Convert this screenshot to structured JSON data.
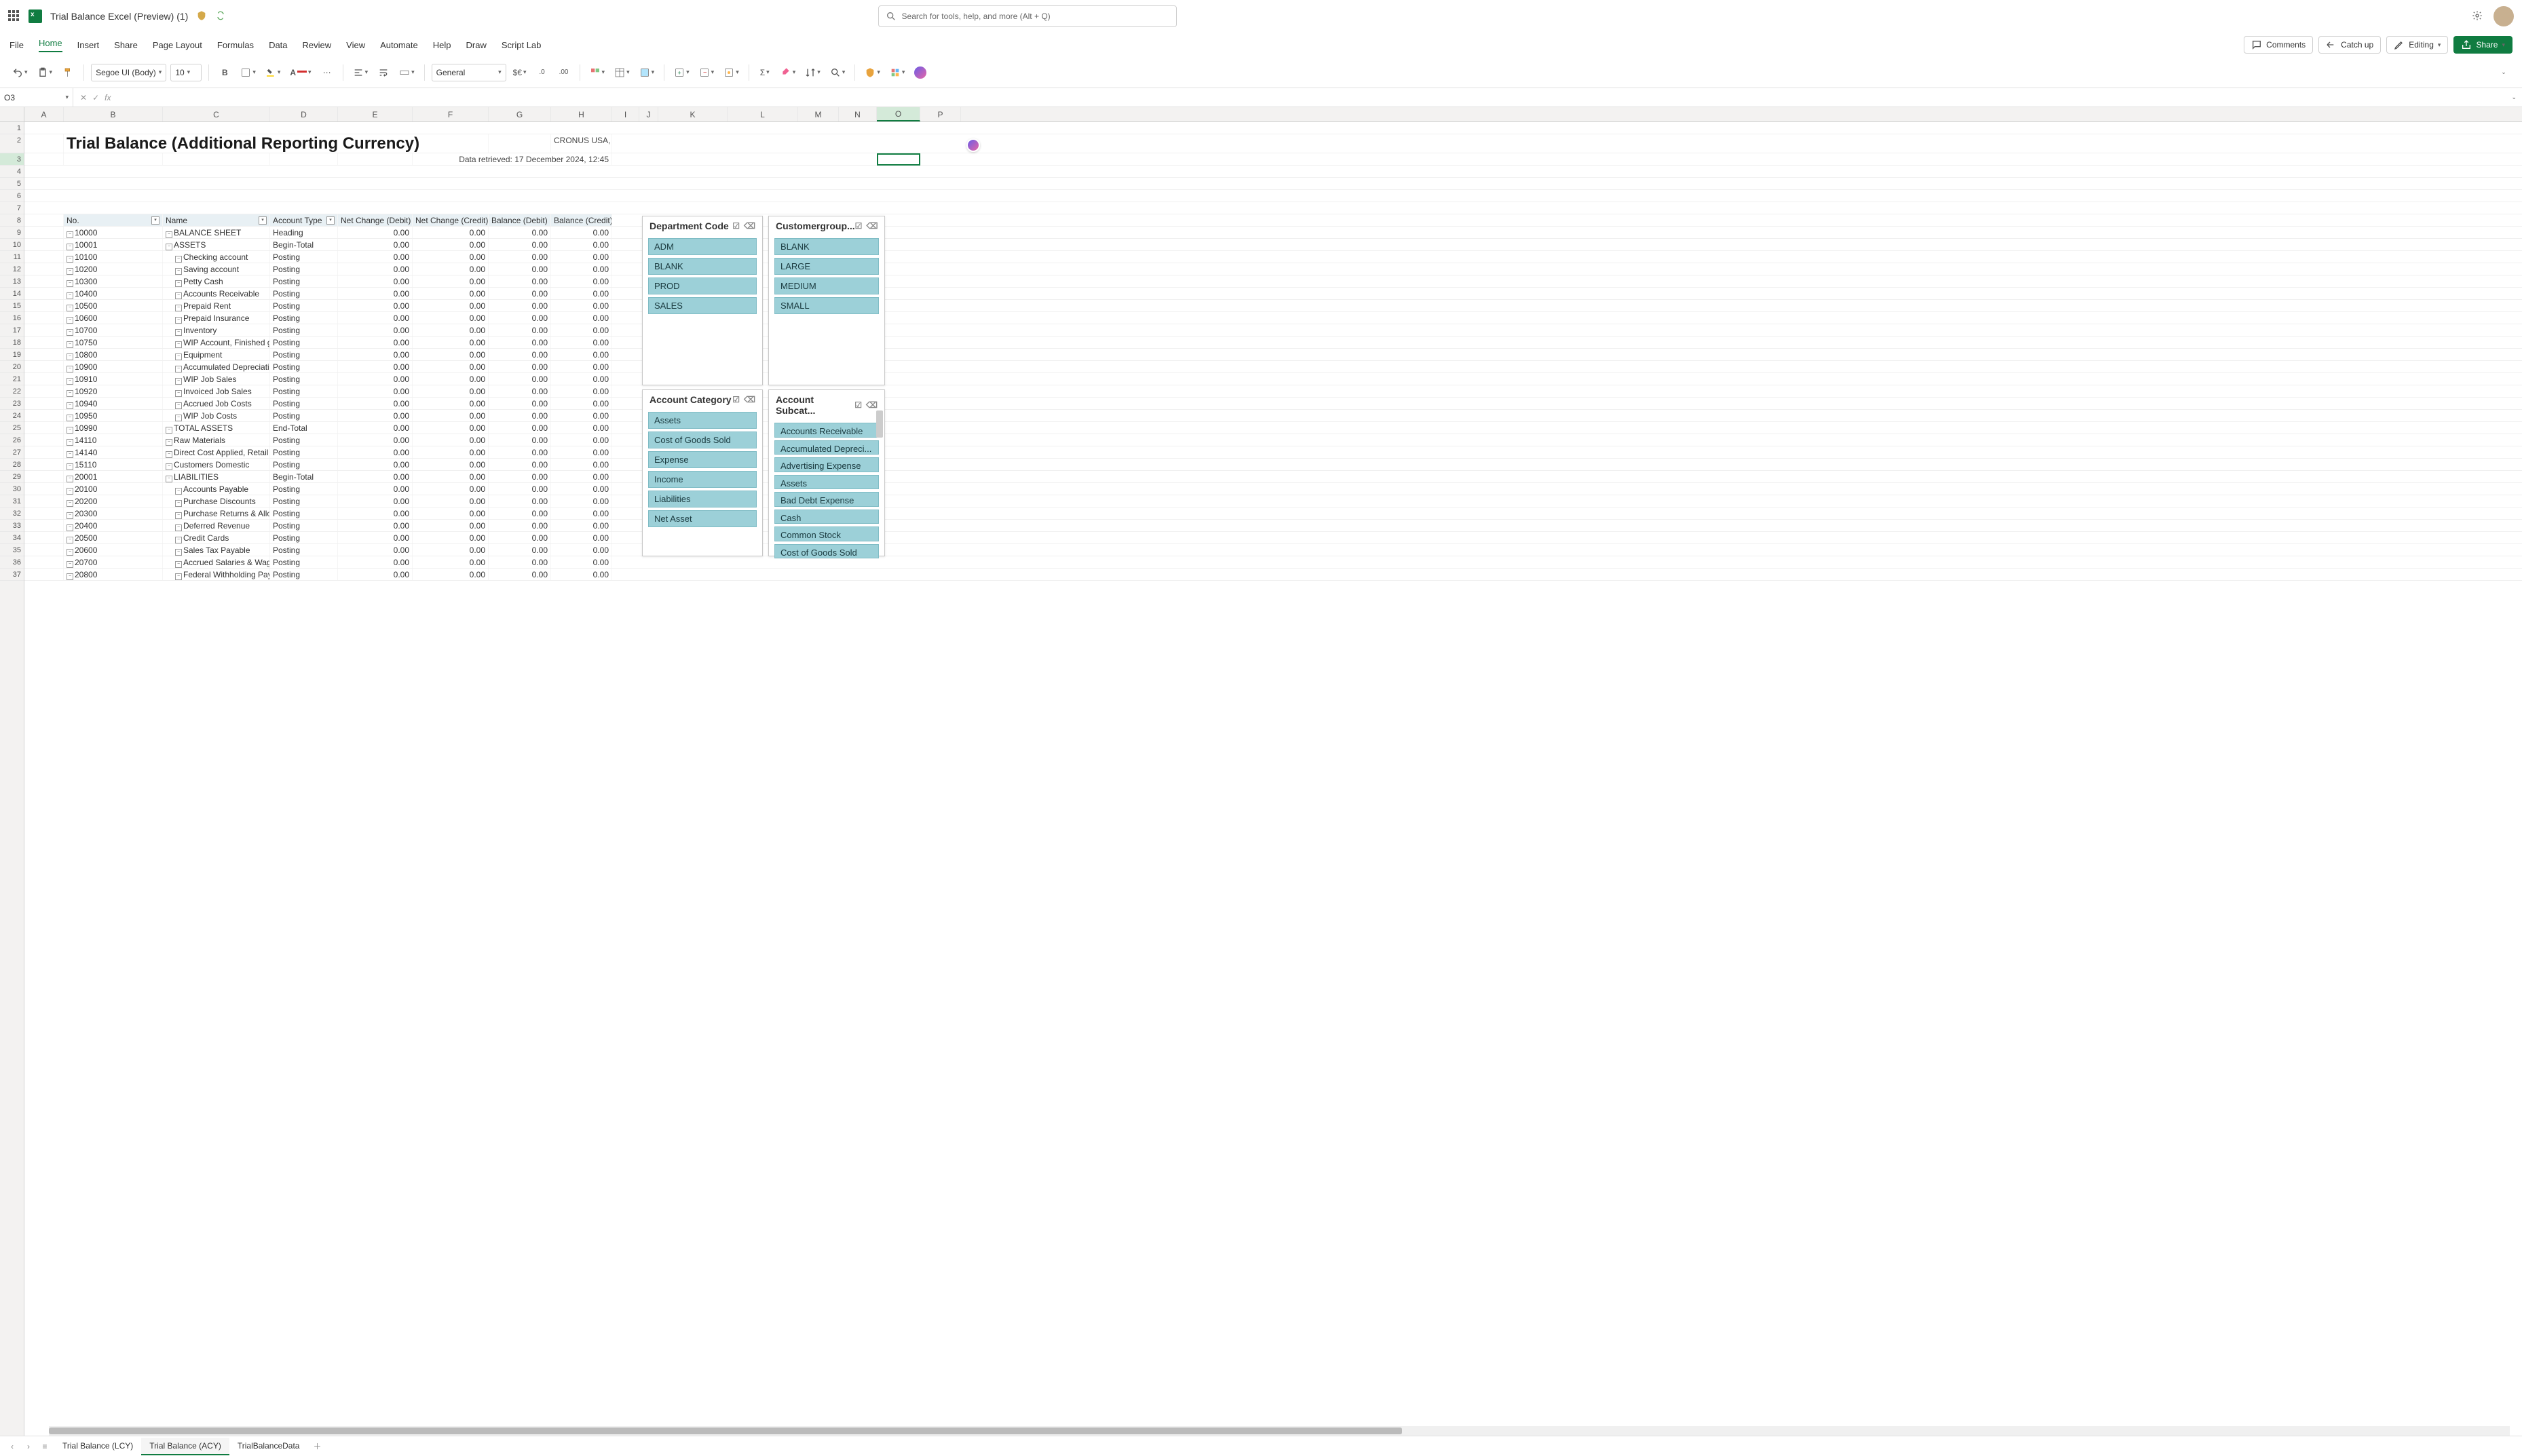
{
  "titlebar": {
    "doc_title": "Trial Balance Excel (Preview) (1)",
    "search_placeholder": "Search for tools, help, and more (Alt + Q)"
  },
  "menubar": {
    "items": [
      "File",
      "Home",
      "Insert",
      "Share",
      "Page Layout",
      "Formulas",
      "Data",
      "Review",
      "View",
      "Automate",
      "Help",
      "Draw",
      "Script Lab"
    ],
    "active_index": 1,
    "comments": "Comments",
    "catchup": "Catch up",
    "editing": "Editing",
    "share": "Share"
  },
  "toolbar": {
    "font_name": "Segoe UI (Body)",
    "font_size": "10",
    "number_format": "General"
  },
  "formula_bar": {
    "name_box": "O3",
    "fx_label": "fx",
    "formula": ""
  },
  "columns": [
    {
      "l": "A",
      "w": 58
    },
    {
      "l": "B",
      "w": 146
    },
    {
      "l": "C",
      "w": 158
    },
    {
      "l": "D",
      "w": 100
    },
    {
      "l": "E",
      "w": 110
    },
    {
      "l": "F",
      "w": 112
    },
    {
      "l": "G",
      "w": 92
    },
    {
      "l": "H",
      "w": 90
    },
    {
      "l": "I",
      "w": 40
    },
    {
      "l": "J",
      "w": 28
    },
    {
      "l": "K",
      "w": 102
    },
    {
      "l": "L",
      "w": 104
    },
    {
      "l": "M",
      "w": 60
    },
    {
      "l": "N",
      "w": 56
    },
    {
      "l": "O",
      "w": 64
    },
    {
      "l": "P",
      "w": 60
    }
  ],
  "active_col_index": 14,
  "report": {
    "title": "Trial Balance (Additional Reporting Currency)",
    "company": "CRONUS USA, Inc.",
    "retrieved": "Data retrieved: 17 December 2024, 12:45"
  },
  "row_numbers": [
    1,
    2,
    3,
    4,
    5,
    6,
    7,
    8,
    9,
    10,
    11,
    12,
    13,
    14,
    15,
    16,
    17,
    18,
    19,
    20,
    21,
    22,
    23,
    24,
    25,
    26,
    27,
    28,
    29,
    30,
    31,
    32,
    33,
    34,
    35,
    36,
    37
  ],
  "active_row": 3,
  "table": {
    "headers": [
      "No.",
      "Name",
      "Account Type",
      "Net Change (Debit)",
      "Net Change (Credit)",
      "Balance (Debit)",
      "Balance (Credit)"
    ],
    "rows": [
      {
        "no": "10000",
        "name": "BALANCE SHEET",
        "type": "Heading",
        "v": [
          "0.00",
          "0.00",
          "0.00",
          "0.00"
        ],
        "lvl": 0
      },
      {
        "no": "10001",
        "name": "ASSETS",
        "type": "Begin-Total",
        "v": [
          "0.00",
          "0.00",
          "0.00",
          "0.00"
        ],
        "lvl": 0
      },
      {
        "no": "10100",
        "name": "Checking account",
        "type": "Posting",
        "v": [
          "0.00",
          "0.00",
          "0.00",
          "0.00"
        ],
        "lvl": 1
      },
      {
        "no": "10200",
        "name": "Saving account",
        "type": "Posting",
        "v": [
          "0.00",
          "0.00",
          "0.00",
          "0.00"
        ],
        "lvl": 1
      },
      {
        "no": "10300",
        "name": "Petty Cash",
        "type": "Posting",
        "v": [
          "0.00",
          "0.00",
          "0.00",
          "0.00"
        ],
        "lvl": 1
      },
      {
        "no": "10400",
        "name": "Accounts Receivable",
        "type": "Posting",
        "v": [
          "0.00",
          "0.00",
          "0.00",
          "0.00"
        ],
        "lvl": 1
      },
      {
        "no": "10500",
        "name": "Prepaid Rent",
        "type": "Posting",
        "v": [
          "0.00",
          "0.00",
          "0.00",
          "0.00"
        ],
        "lvl": 1
      },
      {
        "no": "10600",
        "name": "Prepaid Insurance",
        "type": "Posting",
        "v": [
          "0.00",
          "0.00",
          "0.00",
          "0.00"
        ],
        "lvl": 1
      },
      {
        "no": "10700",
        "name": "Inventory",
        "type": "Posting",
        "v": [
          "0.00",
          "0.00",
          "0.00",
          "0.00"
        ],
        "lvl": 1
      },
      {
        "no": "10750",
        "name": "WIP Account, Finished goods",
        "type": "Posting",
        "v": [
          "0.00",
          "0.00",
          "0.00",
          "0.00"
        ],
        "lvl": 1
      },
      {
        "no": "10800",
        "name": "Equipment",
        "type": "Posting",
        "v": [
          "0.00",
          "0.00",
          "0.00",
          "0.00"
        ],
        "lvl": 1
      },
      {
        "no": "10900",
        "name": "Accumulated Depreciation",
        "type": "Posting",
        "v": [
          "0.00",
          "0.00",
          "0.00",
          "0.00"
        ],
        "lvl": 1
      },
      {
        "no": "10910",
        "name": "WIP Job Sales",
        "type": "Posting",
        "v": [
          "0.00",
          "0.00",
          "0.00",
          "0.00"
        ],
        "lvl": 1
      },
      {
        "no": "10920",
        "name": "Invoiced Job Sales",
        "type": "Posting",
        "v": [
          "0.00",
          "0.00",
          "0.00",
          "0.00"
        ],
        "lvl": 1
      },
      {
        "no": "10940",
        "name": "Accrued Job Costs",
        "type": "Posting",
        "v": [
          "0.00",
          "0.00",
          "0.00",
          "0.00"
        ],
        "lvl": 1
      },
      {
        "no": "10950",
        "name": "WIP Job Costs",
        "type": "Posting",
        "v": [
          "0.00",
          "0.00",
          "0.00",
          "0.00"
        ],
        "lvl": 1
      },
      {
        "no": "10990",
        "name": "TOTAL ASSETS",
        "type": "End-Total",
        "v": [
          "0.00",
          "0.00",
          "0.00",
          "0.00"
        ],
        "lvl": 0
      },
      {
        "no": "14110",
        "name": "Raw Materials",
        "type": "Posting",
        "v": [
          "0.00",
          "0.00",
          "0.00",
          "0.00"
        ],
        "lvl": 0
      },
      {
        "no": "14140",
        "name": "Direct Cost Applied, Retail",
        "type": "Posting",
        "v": [
          "0.00",
          "0.00",
          "0.00",
          "0.00"
        ],
        "lvl": 0
      },
      {
        "no": "15110",
        "name": "Customers Domestic",
        "type": "Posting",
        "v": [
          "0.00",
          "0.00",
          "0.00",
          "0.00"
        ],
        "lvl": 0
      },
      {
        "no": "20001",
        "name": "LIABILITIES",
        "type": "Begin-Total",
        "v": [
          "0.00",
          "0.00",
          "0.00",
          "0.00"
        ],
        "lvl": 0
      },
      {
        "no": "20100",
        "name": "Accounts Payable",
        "type": "Posting",
        "v": [
          "0.00",
          "0.00",
          "0.00",
          "0.00"
        ],
        "lvl": 1
      },
      {
        "no": "20200",
        "name": "Purchase Discounts",
        "type": "Posting",
        "v": [
          "0.00",
          "0.00",
          "0.00",
          "0.00"
        ],
        "lvl": 1
      },
      {
        "no": "20300",
        "name": "Purchase Returns & Allowan",
        "type": "Posting",
        "v": [
          "0.00",
          "0.00",
          "0.00",
          "0.00"
        ],
        "lvl": 1
      },
      {
        "no": "20400",
        "name": "Deferred Revenue",
        "type": "Posting",
        "v": [
          "0.00",
          "0.00",
          "0.00",
          "0.00"
        ],
        "lvl": 1
      },
      {
        "no": "20500",
        "name": "Credit Cards",
        "type": "Posting",
        "v": [
          "0.00",
          "0.00",
          "0.00",
          "0.00"
        ],
        "lvl": 1
      },
      {
        "no": "20600",
        "name": "Sales Tax Payable",
        "type": "Posting",
        "v": [
          "0.00",
          "0.00",
          "0.00",
          "0.00"
        ],
        "lvl": 1
      },
      {
        "no": "20700",
        "name": "Accrued Salaries & Wages",
        "type": "Posting",
        "v": [
          "0.00",
          "0.00",
          "0.00",
          "0.00"
        ],
        "lvl": 1
      },
      {
        "no": "20800",
        "name": "Federal Withholding Payable",
        "type": "Posting",
        "v": [
          "0.00",
          "0.00",
          "0.00",
          "0.00"
        ],
        "lvl": 1
      }
    ]
  },
  "slicers": {
    "dept": {
      "title": "Department Code",
      "items": [
        "ADM",
        "BLANK",
        "PROD",
        "SALES"
      ]
    },
    "cust": {
      "title": "Customergroup...",
      "items": [
        "BLANK",
        "LARGE",
        "MEDIUM",
        "SMALL"
      ]
    },
    "cat": {
      "title": "Account Category",
      "items": [
        "Assets",
        "Cost of Goods Sold",
        "Expense",
        "Income",
        "Liabilities",
        "Net Asset"
      ]
    },
    "sub": {
      "title": "Account Subcat...",
      "items": [
        "Accounts Receivable",
        "Accumulated Depreci...",
        "Advertising Expense",
        "Assets",
        "Bad Debt Expense",
        "Cash",
        "Common Stock",
        "Cost of Goods Sold"
      ]
    }
  },
  "sheets": {
    "tabs": [
      "Trial Balance (LCY)",
      "Trial Balance (ACY)",
      "TrialBalanceData"
    ],
    "active_index": 1
  }
}
